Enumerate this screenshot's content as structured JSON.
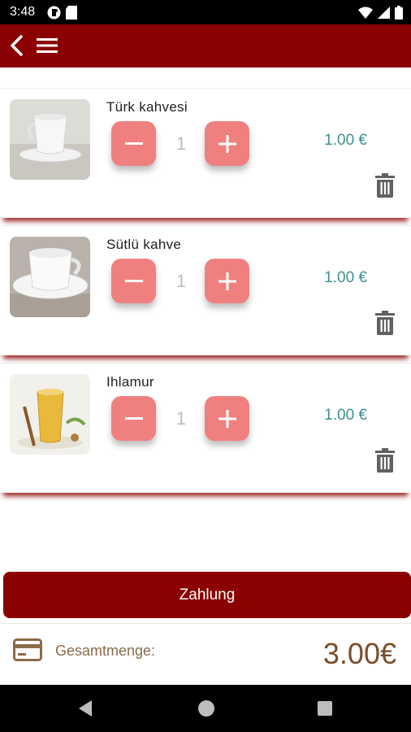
{
  "status_bar": {
    "time": "3:48",
    "left_icons": [
      "app-notification-icon",
      "sd-card-icon"
    ],
    "right_icons": [
      "wifi-icon",
      "signal-icon",
      "battery-icon"
    ]
  },
  "app_bar": {
    "back_icon": "chevron-left-icon",
    "menu_icon": "hamburger-menu-icon",
    "color": "#8b0000"
  },
  "cart": {
    "items": [
      {
        "name": "Türk kahvesi",
        "quantity": "1",
        "price": "1.00 €",
        "image_icon": "coffee-cup-icon"
      },
      {
        "name": "Sütlü kahve",
        "quantity": "1",
        "price": "1.00 €",
        "image_icon": "milk-coffee-cup-icon"
      },
      {
        "name": "Ihlamur",
        "quantity": "1",
        "price": "1.00 €",
        "image_icon": "tea-glass-icon"
      }
    ],
    "quantity_button_color": "#f08080",
    "price_color": "#3f8f8f"
  },
  "payment": {
    "button_label": "Zahlung"
  },
  "total": {
    "label": "Gesamtmenge:",
    "amount": "3.00€",
    "icon": "credit-card-icon"
  },
  "nav_bar": {
    "icons": [
      "nav-back-icon",
      "nav-home-icon",
      "nav-recents-icon"
    ]
  }
}
